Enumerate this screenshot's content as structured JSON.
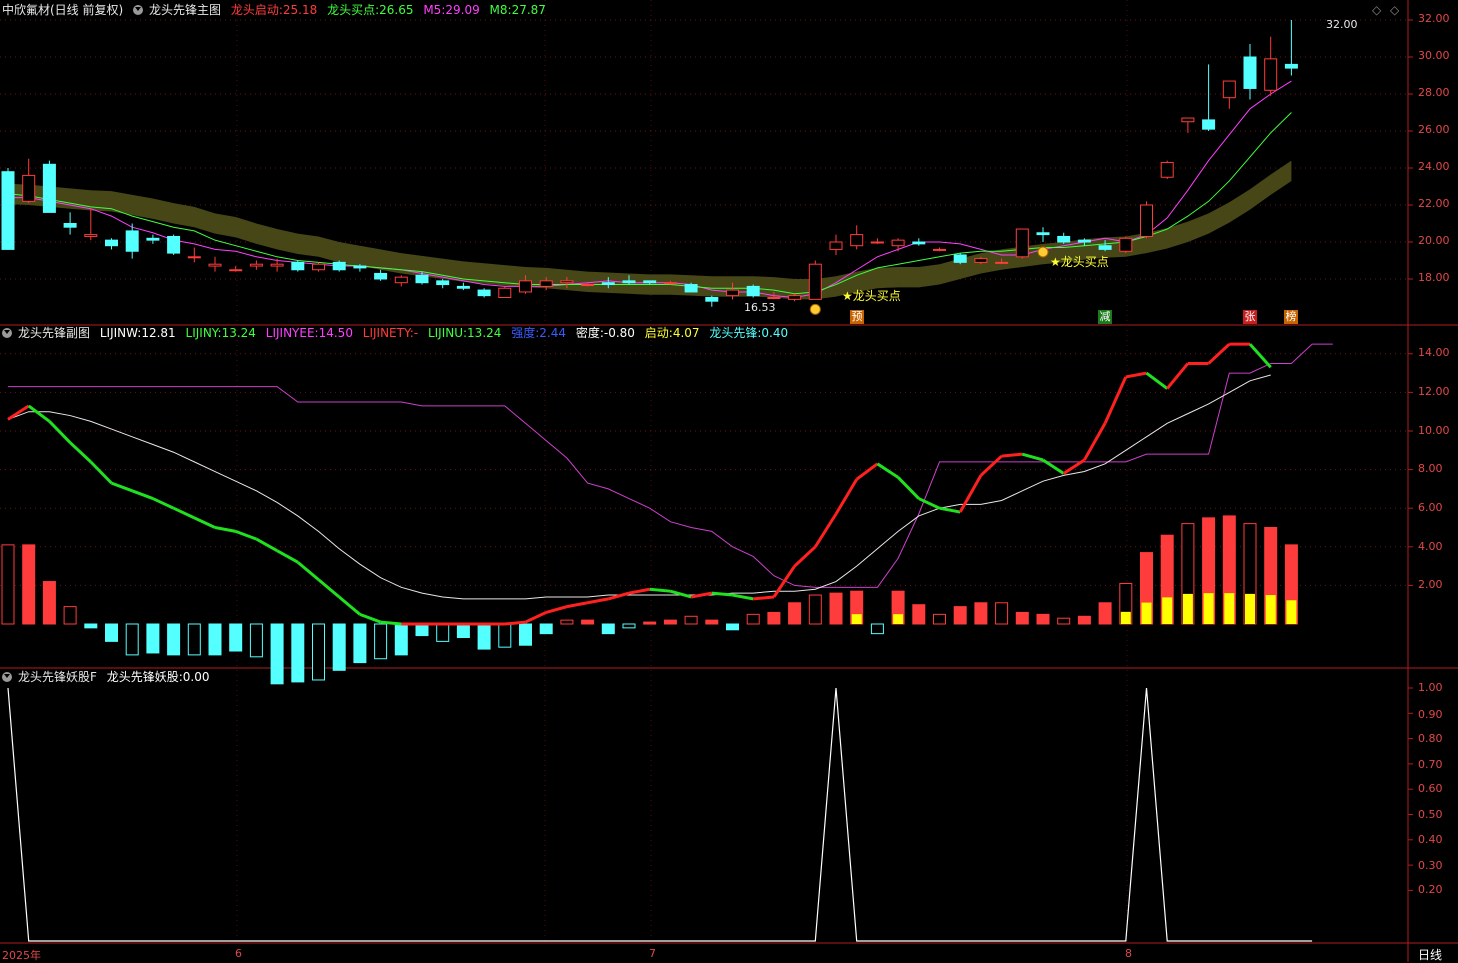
{
  "panel1": {
    "stock": "中欣氟材(日线 前复权)",
    "indicator": "龙头先锋主图",
    "start_label": "龙头启动:",
    "start_val": "25.18",
    "buy_label": "龙头买点:",
    "buy_val": "26.65",
    "m5_label": "M5:",
    "m5_val": "29.09",
    "m8_label": "M8:",
    "m8_val": "27.87",
    "high_label": "32.00",
    "low_label": "16.53",
    "buy_anno": "★龙头买点",
    "tags": [
      "预",
      "减",
      "张",
      "榜"
    ],
    "yticks": [
      "32.00",
      "30.00",
      "28.00",
      "26.00",
      "24.00",
      "22.00",
      "20.00",
      "18.00"
    ]
  },
  "panel2": {
    "indicator": "龙头先锋副图",
    "lijinw_label": "LIJINW:",
    "lijinw_val": "12.81",
    "lijiny_label": "LIJINY:",
    "lijiny_val": "13.24",
    "lijinyee_label": "LIJINYEE:",
    "lijinyee_val": "14.50",
    "lijinety_label": "LIJINETY:",
    "lijinety_val": "-",
    "lijinu_label": "LIJINU:",
    "lijinu_val": "13.24",
    "qiang_label": "强度:",
    "qiang_val": "2.44",
    "midu_label": "密度:",
    "midu_val": "-0.80",
    "qidong_label": "启动:",
    "qidong_val": "4.07",
    "xianfeng_label": "龙头先锋:",
    "xianfeng_val": "0.40",
    "yticks": [
      "14.00",
      "12.00",
      "10.00",
      "8.00",
      "6.00",
      "4.00",
      "2.00"
    ]
  },
  "panel3": {
    "indicator": "龙头先锋妖股F",
    "yao_label": "龙头先锋妖股:",
    "yao_val": "0.00",
    "yticks": [
      "1.00",
      "0.90",
      "0.80",
      "0.70",
      "0.60",
      "0.50",
      "0.40",
      "0.30",
      "0.20"
    ]
  },
  "xaxis": {
    "labels": [
      "2025年",
      "6",
      "7",
      "8"
    ],
    "period": "日线"
  },
  "colors": {
    "up": "#ff3c3c",
    "down": "#54ffff",
    "axis": "#b01e1e",
    "ma5": "#ff40ff",
    "ma8": "#40ff40"
  },
  "chart_data": {
    "type": "candlestick",
    "ohlc": [
      [
        23.8,
        24.0,
        19.6,
        19.6
      ],
      [
        22.2,
        24.5,
        22.1,
        23.6
      ],
      [
        24.2,
        24.4,
        21.6,
        21.6
      ],
      [
        21.0,
        21.6,
        20.4,
        20.8
      ],
      [
        20.3,
        21.8,
        20.1,
        20.4
      ],
      [
        20.1,
        20.2,
        19.6,
        19.8
      ],
      [
        20.6,
        21.0,
        19.1,
        19.5
      ],
      [
        20.2,
        20.4,
        19.9,
        20.1
      ],
      [
        20.3,
        20.4,
        19.3,
        19.4
      ],
      [
        19.2,
        19.7,
        18.9,
        19.2
      ],
      [
        18.7,
        19.2,
        18.4,
        18.8
      ],
      [
        18.5,
        18.7,
        18.4,
        18.5
      ],
      [
        18.7,
        19.0,
        18.5,
        18.8
      ],
      [
        18.7,
        19.1,
        18.4,
        18.8
      ],
      [
        18.9,
        19.0,
        18.4,
        18.5
      ],
      [
        18.5,
        18.9,
        18.4,
        18.8
      ],
      [
        18.9,
        19.0,
        18.4,
        18.5
      ],
      [
        18.7,
        18.8,
        18.4,
        18.6
      ],
      [
        18.3,
        18.5,
        17.9,
        18.0
      ],
      [
        17.8,
        18.2,
        17.6,
        18.1
      ],
      [
        18.2,
        18.4,
        17.7,
        17.8
      ],
      [
        17.9,
        18.0,
        17.5,
        17.7
      ],
      [
        17.6,
        17.8,
        17.4,
        17.5
      ],
      [
        17.4,
        17.5,
        17.0,
        17.1
      ],
      [
        17.0,
        17.6,
        17.0,
        17.5
      ],
      [
        17.3,
        18.2,
        17.2,
        17.9
      ],
      [
        17.6,
        18.1,
        17.4,
        17.9
      ],
      [
        17.8,
        18.1,
        17.5,
        17.9
      ],
      [
        17.7,
        17.8,
        17.6,
        17.7
      ],
      [
        17.8,
        18.1,
        17.5,
        17.7
      ],
      [
        17.9,
        18.2,
        17.7,
        17.8
      ],
      [
        17.9,
        17.9,
        17.7,
        17.8
      ],
      [
        17.8,
        17.9,
        17.7,
        17.8
      ],
      [
        17.7,
        17.8,
        17.3,
        17.3
      ],
      [
        17.0,
        17.1,
        16.5,
        16.8
      ],
      [
        17.1,
        17.8,
        16.9,
        17.4
      ],
      [
        17.6,
        17.7,
        17.0,
        17.1
      ],
      [
        17.0,
        17.3,
        16.9,
        17.0
      ],
      [
        16.9,
        17.2,
        16.8,
        17.1
      ],
      [
        16.9,
        19.0,
        16.9,
        18.8
      ],
      [
        19.6,
        20.4,
        19.3,
        20.0
      ],
      [
        19.8,
        20.9,
        19.6,
        20.4
      ],
      [
        20.0,
        20.2,
        19.9,
        20.0
      ],
      [
        19.8,
        20.2,
        19.5,
        20.1
      ],
      [
        20.0,
        20.2,
        19.8,
        19.9
      ],
      [
        19.6,
        19.7,
        19.5,
        19.6
      ],
      [
        19.3,
        19.4,
        18.8,
        18.9
      ],
      [
        18.9,
        19.2,
        18.8,
        19.1
      ],
      [
        18.9,
        19.1,
        18.8,
        18.9
      ],
      [
        19.2,
        20.7,
        19.1,
        20.7
      ],
      [
        20.5,
        20.8,
        20.0,
        20.4
      ],
      [
        20.3,
        20.5,
        19.9,
        20.0
      ],
      [
        20.1,
        20.2,
        19.8,
        20.0
      ],
      [
        19.8,
        20.1,
        19.5,
        19.6
      ],
      [
        19.5,
        20.3,
        19.4,
        20.2
      ],
      [
        20.3,
        22.2,
        20.2,
        22.0
      ],
      [
        23.5,
        24.4,
        23.4,
        24.3
      ],
      [
        26.5,
        26.7,
        25.9,
        26.7
      ],
      [
        26.6,
        29.6,
        26.0,
        26.1
      ],
      [
        27.8,
        28.7,
        27.2,
        28.7
      ],
      [
        30.0,
        30.7,
        27.7,
        28.3
      ],
      [
        28.2,
        31.1,
        27.9,
        29.9
      ],
      [
        29.6,
        32.0,
        29.0,
        29.4
      ]
    ],
    "ma5": [
      22.4,
      22.4,
      22.2,
      22.0,
      21.8,
      21.4,
      20.8,
      20.5,
      20.1,
      19.9,
      19.6,
      19.5,
      19.2,
      19.0,
      18.9,
      18.8,
      18.7,
      18.7,
      18.6,
      18.5,
      18.3,
      18.1,
      17.9,
      17.7,
      17.6,
      17.6,
      17.6,
      17.7,
      17.8,
      17.9,
      17.8,
      17.8,
      17.8,
      17.7,
      17.4,
      17.3,
      17.3,
      17.1,
      17.0,
      17.2,
      17.8,
      18.5,
      19.2,
      19.6,
      20.0,
      20.0,
      19.9,
      19.6,
      19.3,
      19.3,
      19.6,
      19.8,
      20.0,
      20.2,
      20.0,
      20.4,
      21.3,
      22.8,
      24.4,
      25.8,
      27.2,
      28.0,
      28.7,
      29.1
    ],
    "ma8": [
      22.6,
      22.5,
      22.3,
      22.1,
      21.9,
      21.8,
      21.4,
      21.1,
      20.8,
      20.6,
      20.1,
      19.8,
      19.5,
      19.2,
      19.0,
      18.9,
      18.8,
      18.7,
      18.6,
      18.5,
      18.4,
      18.2,
      18.0,
      17.9,
      17.8,
      17.7,
      17.7,
      17.7,
      17.7,
      17.7,
      17.7,
      17.7,
      17.7,
      17.6,
      17.5,
      17.5,
      17.5,
      17.4,
      17.2,
      17.3,
      17.7,
      18.2,
      18.6,
      18.8,
      19.0,
      19.2,
      19.4,
      19.5,
      19.5,
      19.6,
      19.7,
      19.7,
      19.8,
      19.9,
      20.0,
      20.3,
      20.7,
      21.4,
      22.2,
      23.3,
      24.6,
      25.9,
      27.0,
      27.9
    ],
    "sub_white": [
      10.6,
      11.0,
      11.0,
      10.8,
      10.5,
      10.1,
      9.7,
      9.3,
      8.9,
      8.4,
      7.9,
      7.4,
      6.9,
      6.3,
      5.6,
      4.8,
      3.9,
      3.1,
      2.4,
      1.9,
      1.6,
      1.4,
      1.3,
      1.3,
      1.3,
      1.3,
      1.4,
      1.4,
      1.4,
      1.5,
      1.5,
      1.5,
      1.5,
      1.5,
      1.5,
      1.6,
      1.6,
      1.7,
      1.7,
      1.8,
      2.2,
      3.0,
      3.9,
      4.8,
      5.6,
      6.0,
      6.2,
      6.2,
      6.4,
      6.9,
      7.4,
      7.7,
      7.9,
      8.3,
      9.0,
      9.7,
      10.4,
      10.9,
      11.4,
      12.0,
      12.6,
      12.9
    ],
    "sub_line": [
      10.6,
      11.3,
      10.5,
      9.4,
      8.4,
      7.3,
      6.9,
      6.5,
      6.0,
      5.5,
      5.0,
      4.8,
      4.4,
      3.8,
      3.2,
      2.3,
      1.4,
      0.5,
      0.1,
      0.0,
      0.0,
      0.0,
      0.0,
      0.0,
      0.0,
      0.1,
      0.6,
      0.9,
      1.1,
      1.3,
      1.6,
      1.8,
      1.7,
      1.4,
      1.6,
      1.5,
      1.3,
      1.4,
      3.0,
      4.0,
      5.7,
      7.5,
      8.3,
      7.6,
      6.5,
      6.0,
      5.8,
      7.7,
      8.7,
      8.8,
      8.5,
      7.8,
      8.5,
      10.4,
      12.8,
      13.0,
      12.2,
      13.5,
      13.5,
      14.5,
      14.5,
      13.3
    ],
    "sub_magenta": [
      12.3,
      12.3,
      12.3,
      12.3,
      12.3,
      12.3,
      12.3,
      12.3,
      12.3,
      12.3,
      12.3,
      12.3,
      12.3,
      12.3,
      11.5,
      11.5,
      11.5,
      11.5,
      11.5,
      11.5,
      11.3,
      11.3,
      11.3,
      11.3,
      11.3,
      10.4,
      9.5,
      8.6,
      7.3,
      7.0,
      6.5,
      6.0,
      5.3,
      5.0,
      4.8,
      4.0,
      3.5,
      2.5,
      2.0,
      1.9,
      1.9,
      1.9,
      1.9,
      3.4,
      5.7,
      8.4,
      8.4,
      8.4,
      8.4,
      8.4,
      8.4,
      8.4,
      8.4,
      8.4,
      8.4,
      8.8,
      8.8,
      8.8,
      8.8,
      13.0,
      13.0,
      13.5,
      13.5,
      14.5,
      14.5
    ],
    "sub_bars": [
      4.1,
      4.1,
      2.2,
      0.9,
      -0.2,
      -0.9,
      -1.6,
      -1.5,
      -1.6,
      -1.6,
      -1.6,
      -1.4,
      -1.7,
      -3.1,
      -3.0,
      -2.9,
      -2.4,
      -2.0,
      -1.8,
      -1.6,
      -0.6,
      -0.9,
      -0.7,
      -1.3,
      -1.2,
      -1.1,
      -0.5,
      0.2,
      0.2,
      -0.5,
      -0.2,
      0.1,
      0.2,
      0.4,
      0.2,
      -0.3,
      0.5,
      0.6,
      1.1,
      1.5,
      1.6,
      1.7,
      -0.5,
      1.7,
      1.0,
      0.5,
      0.9,
      1.1,
      1.1,
      0.6,
      0.5,
      0.3,
      0.4,
      1.1,
      2.1,
      3.7,
      4.6,
      5.2,
      5.5,
      5.6,
      5.2,
      5.0,
      4.1
    ],
    "yao": [
      1.0,
      0,
      0,
      0,
      0,
      0,
      0,
      0,
      0,
      0,
      0,
      0,
      0,
      0,
      0,
      0,
      0,
      0,
      0,
      0,
      0,
      0,
      0,
      0,
      0,
      0,
      0,
      0,
      0,
      0,
      0,
      0,
      0,
      0,
      0,
      0,
      0,
      0,
      0,
      0,
      1.0,
      0,
      0,
      0,
      0,
      0,
      0,
      0,
      0,
      0,
      0,
      0,
      0,
      0,
      0,
      1.0,
      0,
      0,
      0,
      0,
      0,
      0,
      0,
      0
    ]
  }
}
